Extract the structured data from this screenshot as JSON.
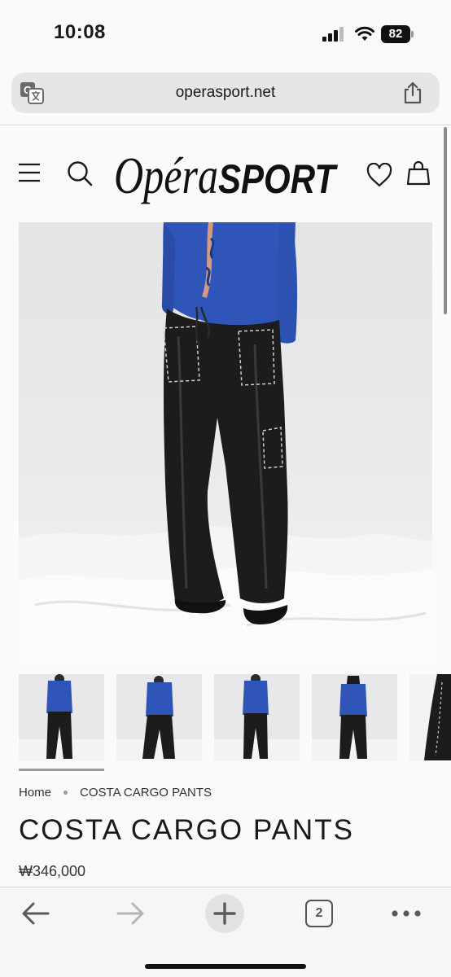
{
  "status_bar": {
    "time": "10:08",
    "battery": "82"
  },
  "browser": {
    "url": "operasport.net",
    "tab_count": "2"
  },
  "site": {
    "logo_script": "Opéra",
    "logo_bold": "SPORT"
  },
  "gallery": {
    "thumbnail_count": 5,
    "active_thumbnail": 1
  },
  "breadcrumb": {
    "home": "Home",
    "current": "COSTA CARGO PANTS"
  },
  "product": {
    "title": "COSTA CARGO PANTS",
    "price": "₩346,000"
  },
  "icons": [
    "translate-icon",
    "share-icon",
    "menu-icon",
    "search-icon",
    "heart-icon",
    "bag-icon",
    "back-arrow-icon",
    "forward-arrow-icon",
    "plus-icon",
    "tabs-icon",
    "more-icon"
  ],
  "colors": {
    "top": "#2f55b8",
    "pants": "#1c1c1c",
    "background": "#fbfaf8"
  }
}
